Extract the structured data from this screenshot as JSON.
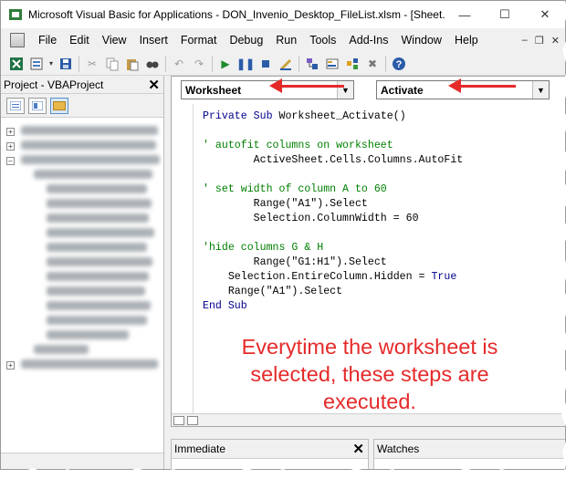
{
  "window": {
    "title": "Microsoft Visual Basic for Applications - DON_Invenio_Desktop_FileList.xlsm - [Sheet...",
    "minimize": "—",
    "maximize": "☐",
    "close": "✕"
  },
  "menubar": {
    "items": [
      "File",
      "Edit",
      "View",
      "Insert",
      "Format",
      "Debug",
      "Run",
      "Tools",
      "Add-Ins",
      "Window",
      "Help"
    ],
    "right_controls": [
      "–",
      "❐",
      "✕"
    ]
  },
  "toolbar": {
    "icons": [
      "excel-icon",
      "insert-module-icon",
      "save-icon",
      "cut-icon",
      "copy-icon",
      "paste-icon",
      "find-icon",
      "undo-icon",
      "redo-icon",
      "run-icon",
      "break-icon",
      "reset-icon",
      "design-mode-icon",
      "project-explorer-icon",
      "properties-icon",
      "object-browser-icon",
      "toolbox-icon",
      "help-icon"
    ]
  },
  "project_pane": {
    "title": "Project - VBAProject",
    "close": "✕"
  },
  "code_pane": {
    "object_combo": "Worksheet",
    "procedure_combo": "Activate",
    "lines": [
      [
        {
          "t": "Private Sub ",
          "c": "kw"
        },
        {
          "t": "Worksheet_Activate()",
          "c": ""
        }
      ],
      [],
      [
        {
          "t": "' autofit columns on worksheet",
          "c": "cm"
        }
      ],
      [
        {
          "t": "        ActiveSheet.Cells.Columns.AutoFit",
          "c": ""
        }
      ],
      [],
      [
        {
          "t": "' set width of column A to 60",
          "c": "cm"
        }
      ],
      [
        {
          "t": "        Range(\"A1\").Select",
          "c": ""
        }
      ],
      [
        {
          "t": "        Selection.ColumnWidth = 60",
          "c": ""
        }
      ],
      [],
      [
        {
          "t": "'hide columns G & H",
          "c": "cm"
        }
      ],
      [
        {
          "t": "        Range(\"G1:H1\").Select",
          "c": ""
        }
      ],
      [
        {
          "t": "    Selection.EntireColumn.Hidden = ",
          "c": ""
        },
        {
          "t": "True",
          "c": "kw"
        }
      ],
      [
        {
          "t": "    Range(\"A1\").Select",
          "c": ""
        }
      ],
      [
        {
          "t": "End Sub",
          "c": "kw"
        }
      ]
    ]
  },
  "annotation": {
    "text_lines": [
      "Everytime the worksheet is",
      "selected, these steps are",
      "executed."
    ],
    "color": "#e52a2a"
  },
  "immediate_pane": {
    "title": "Immediate",
    "close": "✕"
  },
  "watches_pane": {
    "title": "Watches"
  }
}
